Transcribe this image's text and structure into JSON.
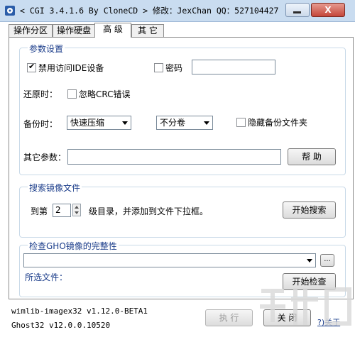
{
  "window": {
    "title": "< CGI 3.4.1.6 By CloneCD > 修改：JexChan  QQ：527104427",
    "close_glyph": "X"
  },
  "tabs": [
    {
      "label": "操作分区"
    },
    {
      "label": "操作硬盘"
    },
    {
      "label": "高 级"
    },
    {
      "label": "其 它"
    }
  ],
  "params_group": {
    "title": "参数设置",
    "ide_access": {
      "label": "禁用访问IDE设备",
      "checked": true
    },
    "password": {
      "label": "密码",
      "checked": false,
      "value": ""
    },
    "restore_label": "还原时：",
    "ignore_crc": {
      "label": "忽略CRC错误",
      "checked": false
    },
    "backup_label": "备份时：",
    "compress_select": {
      "value": "快速压缩"
    },
    "split_select": {
      "value": "不分卷"
    },
    "hide_backup": {
      "label": "隐藏备份文件夹",
      "checked": false
    },
    "other_params_label": "其它参数：",
    "other_params_value": "",
    "help_button": "帮 助"
  },
  "search_group": {
    "title": "搜索镜像文件",
    "prefix": "到第",
    "level": "2",
    "suffix": "级目录，并添加到文件下拉框。",
    "start_button": "开始搜索"
  },
  "check_group": {
    "title": "检查GHO镜像的完整性",
    "file_value": "",
    "browse_button": "...",
    "selected_label": "所选文件：",
    "check_button": "开始检查"
  },
  "footer": {
    "wimlib": "wimlib-imagex32 v1.12.0-BETA1",
    "ghost": "Ghost32 v12.0.0.10520",
    "execute_button": "执 行",
    "close_button": "关 闭",
    "about_link": "关于"
  },
  "colors": {
    "accent": "#1a3c8a",
    "title_bg": "#c9dcf0",
    "close_red": "#c4463a"
  }
}
